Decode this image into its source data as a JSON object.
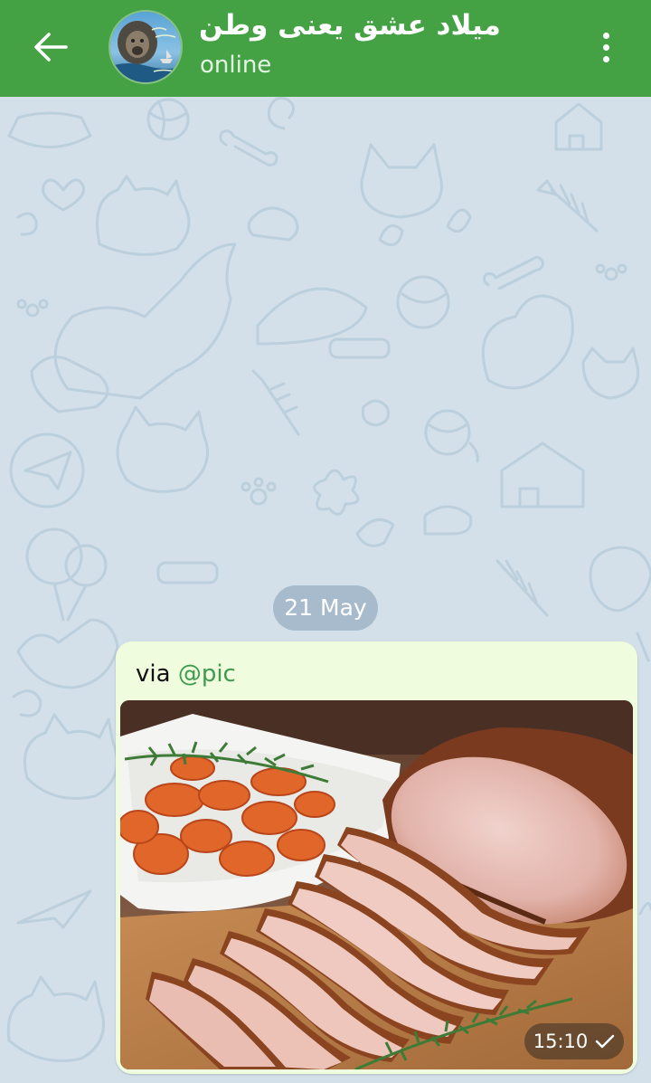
{
  "header": {
    "back_icon": "arrow-left-icon",
    "title": "میلاد عشق یعنی وطن",
    "status": "online",
    "menu_icon": "more-vertical-icon",
    "color": "#44a244"
  },
  "chat": {
    "background_color": "#d3e0ea",
    "date_separator": "21 May",
    "message": {
      "via_prefix": "via",
      "via_handle": "@pic",
      "photo_description_icon": "photo-roast-meat",
      "time": "15:10",
      "status_icon": "single-check-icon",
      "bubble_color": "#effdde"
    }
  }
}
